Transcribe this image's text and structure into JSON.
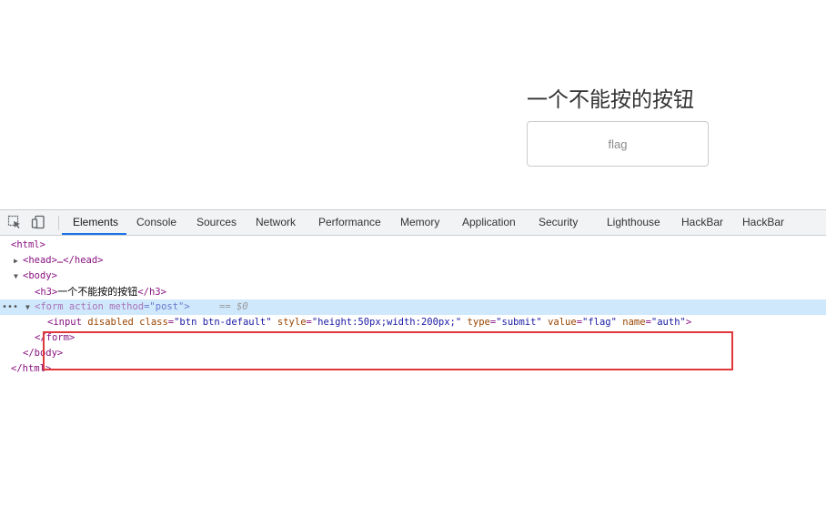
{
  "page": {
    "heading": "一个不能按的按钮",
    "button_value": "flag"
  },
  "devtools": {
    "toolbar_icons": [
      "inspect-element-icon",
      "device-toggle-icon"
    ],
    "tabs": [
      {
        "label": "Elements",
        "active": true
      },
      {
        "label": "Console"
      },
      {
        "label": "Sources"
      },
      {
        "label": "Network"
      },
      {
        "label": "Performance"
      },
      {
        "label": "Memory"
      },
      {
        "label": "Application"
      },
      {
        "label": "Security"
      },
      {
        "label": "Lighthouse"
      },
      {
        "label": "HackBar"
      },
      {
        "label": "HackBar"
      }
    ],
    "dom": {
      "html_open": "<html>",
      "head": "<head>…</head>",
      "body_open": "<body>",
      "h3_open": "<h3>",
      "h3_text": "一个不能按的按钮",
      "h3_close": "</h3>",
      "form_open_tag": "<form action method",
      "form_open_rest": "=\"post\">",
      "eq0": "== $0",
      "input_tag": "<input",
      "input_attr_disabled": "disabled",
      "input_attr_class": "class",
      "input_val_class": "\"btn btn-default\"",
      "input_attr_style": "style",
      "input_val_style": "\"height:50px;width:200px;\"",
      "input_attr_type": "type",
      "input_val_type": "\"submit\"",
      "input_attr_value": "value",
      "input_val_value": "\"flag\"",
      "input_attr_name": "name",
      "input_val_name": "\"auth\"",
      "input_end": ">",
      "form_close": "</form>",
      "body_close": "</body>",
      "html_close": "</html>",
      "row_menu": "•••"
    },
    "highlight_color": "#e0373b",
    "accent_color": "#1a73e8"
  }
}
